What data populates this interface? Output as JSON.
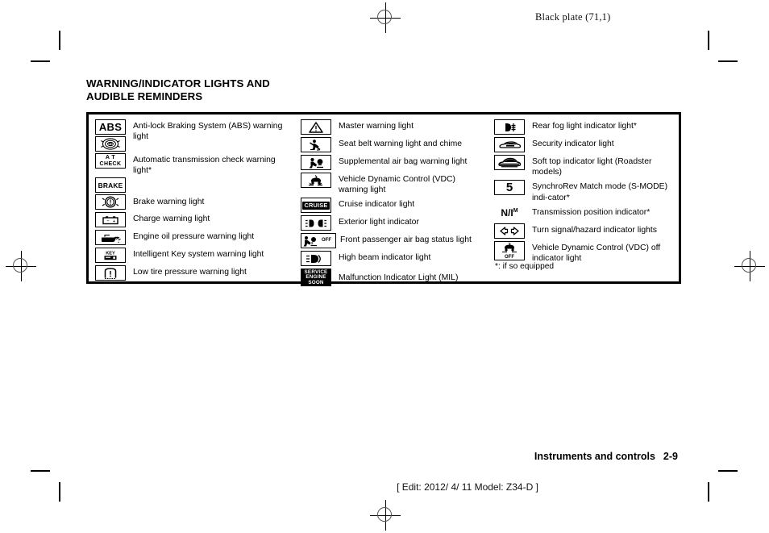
{
  "header": {
    "black_plate": "Black plate (71,1)"
  },
  "heading": {
    "line1": "WARNING/INDICATOR LIGHTS AND",
    "line2": "AUDIBLE REMINDERS"
  },
  "footer": {
    "section": "Instruments and controls",
    "page_number": "2-9",
    "edit_line": "[ Edit: 2012/ 4/ 11   Model: Z34-D ]"
  },
  "table": {
    "footnote": "*: if so equipped",
    "columns": [
      {
        "name": "column-1",
        "rows": [
          {
            "icon": "abs-text-icon",
            "label": "Anti-lock Braking System (ABS) warning light"
          },
          {
            "icon": "abs-circle-icon",
            "label": ""
          },
          {
            "icon": "at-check-text-icon",
            "label": "Automatic transmission check warning light*"
          },
          {
            "icon": "brake-text-icon",
            "label": ""
          },
          {
            "icon": "brake-circle-exclamation-icon",
            "label": "Brake warning light"
          },
          {
            "icon": "battery-charge-icon",
            "label": "Charge warning light"
          },
          {
            "icon": "oil-can-icon",
            "label": "Engine oil pressure warning light"
          },
          {
            "icon": "intelligent-key-icon",
            "label": "Intelligent Key system warning light"
          },
          {
            "icon": "low-tire-pressure-icon",
            "label": "Low tire pressure warning light"
          }
        ]
      },
      {
        "name": "column-2",
        "rows": [
          {
            "icon": "master-warning-triangle-icon",
            "label": "Master warning light"
          },
          {
            "icon": "seat-belt-icon",
            "label": "Seat belt warning light and chime"
          },
          {
            "icon": "supplemental-air-bag-icon",
            "label": "Supplemental air bag warning light"
          },
          {
            "icon": "vdc-warning-icon",
            "label": "Vehicle Dynamic Control (VDC) warning light"
          },
          {
            "icon": "cruise-text-icon",
            "label": "Cruise indicator light"
          },
          {
            "icon": "exterior-light-icon",
            "label": "Exterior light indicator"
          },
          {
            "icon": "passenger-air-bag-off-icon",
            "label": "Front passenger air bag status light"
          },
          {
            "icon": "high-beam-icon",
            "label": "High beam indicator light"
          },
          {
            "icon": "service-engine-soon-icon",
            "label": "Malfunction Indicator Light (MIL)"
          }
        ]
      },
      {
        "name": "column-3",
        "rows": [
          {
            "icon": "rear-fog-light-icon",
            "label": "Rear fog light indicator light*"
          },
          {
            "icon": "security-car-icon",
            "label": "Security indicator light"
          },
          {
            "icon": "soft-top-icon",
            "label": "Soft top indicator light (Roadster models)"
          },
          {
            "icon": "gear-five-icon",
            "label": "SynchroRev Match mode (S-MODE) indi-cator*"
          },
          {
            "icon": "transmission-position-icon",
            "label": "Transmission position indicator*"
          },
          {
            "icon": "turn-signal-arrows-icon",
            "label": "Turn signal/hazard indicator lights"
          },
          {
            "icon": "vdc-off-icon",
            "label": "Vehicle Dynamic Control (VDC) off indicator light"
          }
        ]
      }
    ]
  }
}
